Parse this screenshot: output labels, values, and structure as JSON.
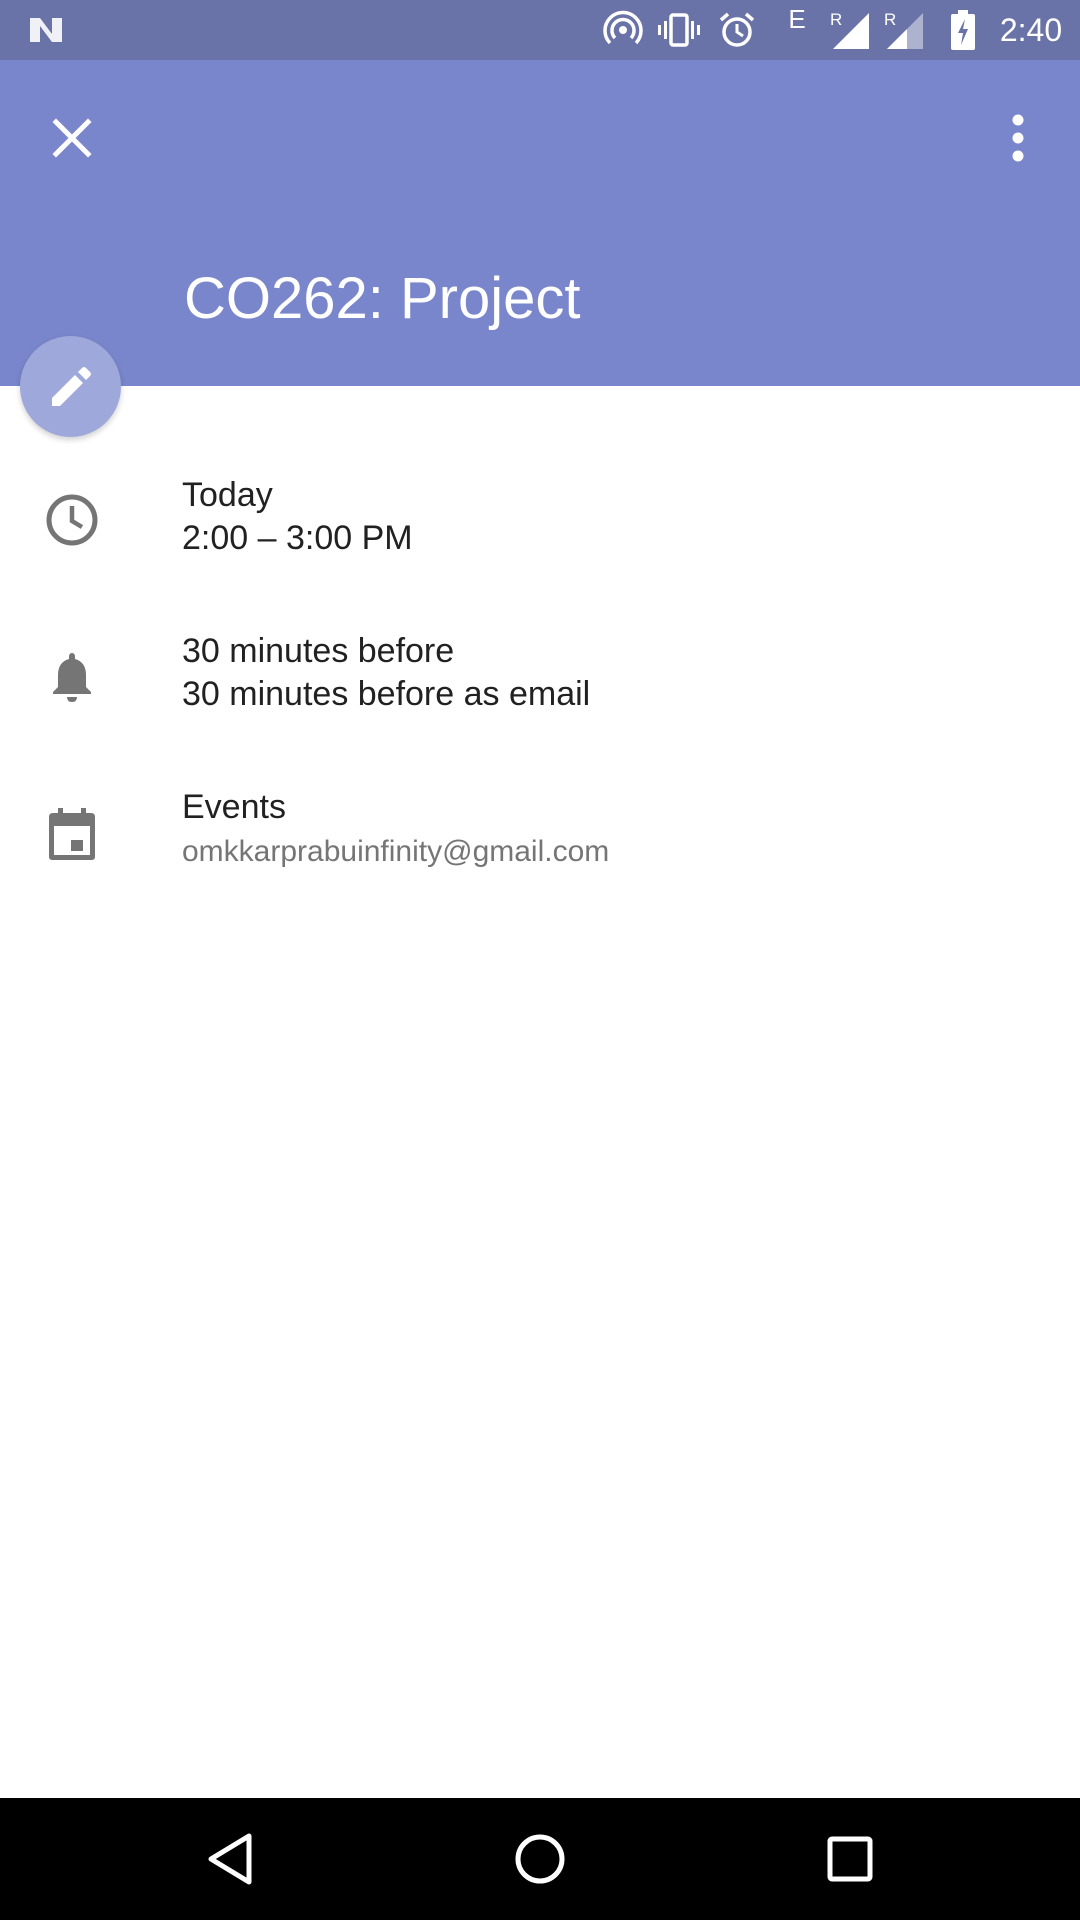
{
  "status_bar": {
    "time": "2:40",
    "network_label": "E",
    "roaming_1": "R",
    "roaming_2": "R",
    "icons": [
      "n-logo-icon",
      "hotspot-icon",
      "vibrate-icon",
      "alarm-icon",
      "signal-icon",
      "signal-icon",
      "battery-charging-icon"
    ]
  },
  "header": {
    "title": "CO262: Project",
    "close_icon": "close-icon",
    "more_icon": "more-vert-icon",
    "background_color": "#7986cb"
  },
  "fab": {
    "icon": "edit-icon",
    "color": "#9fa8da"
  },
  "details": {
    "time": {
      "icon": "clock-icon",
      "day": "Today",
      "range": "2:00 – 3:00 PM"
    },
    "reminders": {
      "icon": "bell-icon",
      "first": "30 minutes before",
      "second": "30 minutes before as email"
    },
    "calendar": {
      "icon": "calendar-icon",
      "name": "Events",
      "account": "omkkarprabuinfinity@gmail.com"
    }
  },
  "nav_bar": {
    "icons": [
      "back-icon",
      "home-icon",
      "recents-icon"
    ]
  }
}
